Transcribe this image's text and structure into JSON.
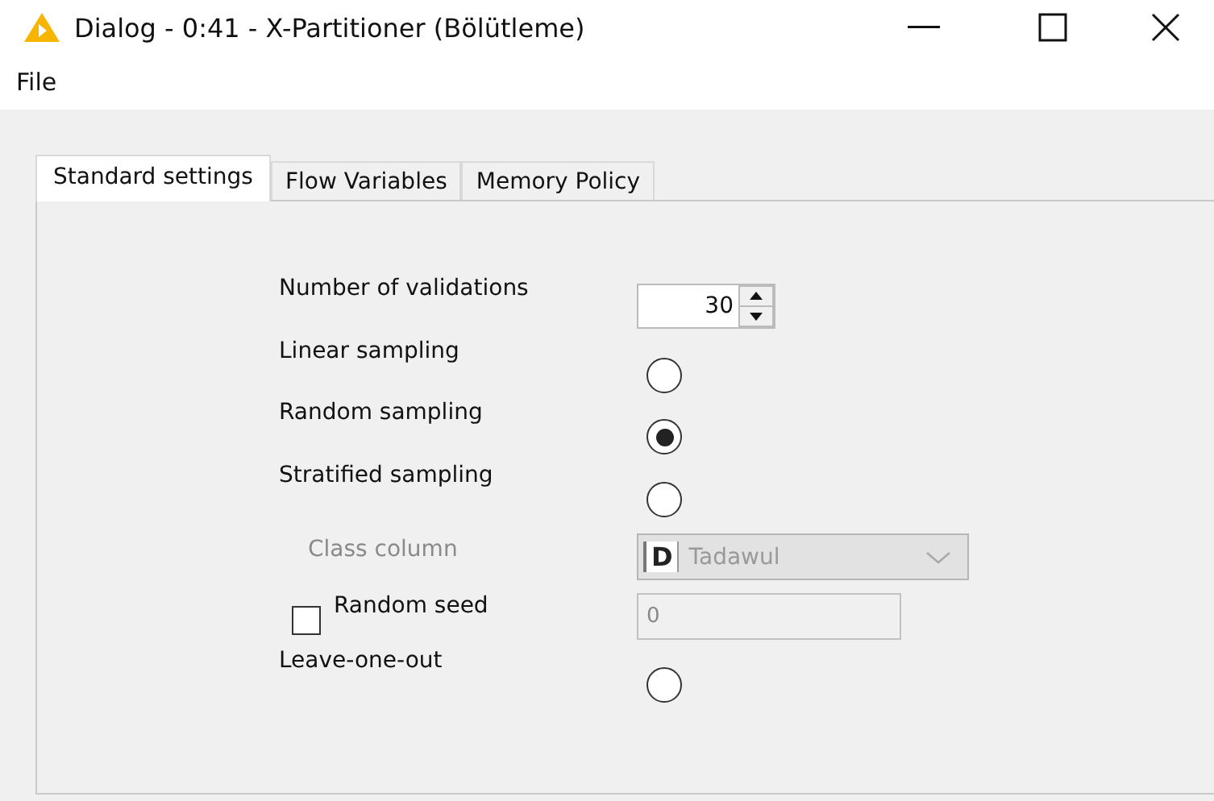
{
  "window": {
    "title": "Dialog - 0:41 - X-Partitioner (Bölütleme)"
  },
  "menu": [
    "File"
  ],
  "tabs": [
    {
      "label": "Standard settings",
      "selected": true
    },
    {
      "label": "Flow Variables",
      "selected": false
    },
    {
      "label": "Memory Policy",
      "selected": false
    }
  ],
  "settings": [
    {
      "kind": "spinner",
      "label": "Number of validations",
      "value": "30"
    },
    {
      "kind": "radio",
      "label": "Linear sampling",
      "selected": false
    },
    {
      "kind": "radio",
      "label": "Random sampling",
      "selected": true
    },
    {
      "kind": "radio",
      "label": "Stratified sampling",
      "selected": false
    },
    {
      "kind": "combo",
      "label": "Class column",
      "type_badge": "D",
      "value": "Tadawul",
      "disabled": true
    },
    {
      "kind": "checkbox",
      "label": "Random seed",
      "checked": false,
      "value": "0"
    },
    {
      "kind": "radio",
      "label": "Leave-one-out",
      "selected": false
    }
  ]
}
